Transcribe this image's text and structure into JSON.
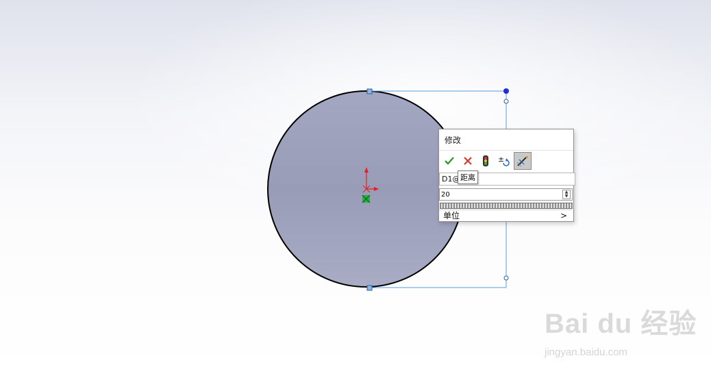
{
  "dialog": {
    "title": "修改",
    "toolbar": {
      "ok_icon": "check-icon",
      "cancel_icon": "x-icon",
      "rebuild_icon": "traffic-light-icon",
      "reverse_icon": "plus-minus-icon",
      "mark_dimension_icon": "dimension-mark-icon"
    },
    "dimension_name": "D1@",
    "tooltip": "距离",
    "value": "20",
    "units_label": "单位",
    "units_arrow": ">"
  },
  "watermark": {
    "logo": "Bai du 经验",
    "url": "jingyan.baidu.com"
  },
  "colors": {
    "circle_fill": "#9b9fbb",
    "dimension_line": "#5a9bdc",
    "endpoint_blue": "#1f2fd6",
    "ok_green": "#2f9a2f",
    "cancel_red": "#d43a2a"
  }
}
